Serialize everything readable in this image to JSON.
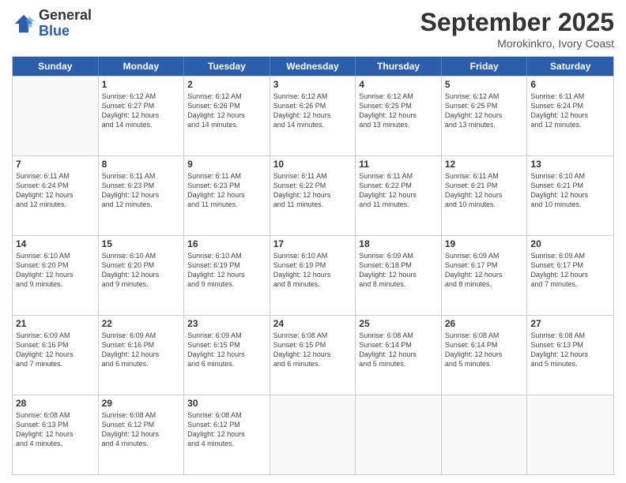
{
  "header": {
    "logo_general": "General",
    "logo_blue": "Blue",
    "month": "September 2025",
    "location": "Morokinkro, Ivory Coast"
  },
  "weekdays": [
    "Sunday",
    "Monday",
    "Tuesday",
    "Wednesday",
    "Thursday",
    "Friday",
    "Saturday"
  ],
  "weeks": [
    [
      {
        "day": null,
        "info": null
      },
      {
        "day": "1",
        "info": "Sunrise: 6:12 AM\nSunset: 6:27 PM\nDaylight: 12 hours\nand 14 minutes."
      },
      {
        "day": "2",
        "info": "Sunrise: 6:12 AM\nSunset: 6:26 PM\nDaylight: 12 hours\nand 14 minutes."
      },
      {
        "day": "3",
        "info": "Sunrise: 6:12 AM\nSunset: 6:26 PM\nDaylight: 12 hours\nand 14 minutes."
      },
      {
        "day": "4",
        "info": "Sunrise: 6:12 AM\nSunset: 6:25 PM\nDaylight: 12 hours\nand 13 minutes."
      },
      {
        "day": "5",
        "info": "Sunrise: 6:12 AM\nSunset: 6:25 PM\nDaylight: 12 hours\nand 13 minutes."
      },
      {
        "day": "6",
        "info": "Sunrise: 6:11 AM\nSunset: 6:24 PM\nDaylight: 12 hours\nand 12 minutes."
      }
    ],
    [
      {
        "day": "7",
        "info": "Sunrise: 6:11 AM\nSunset: 6:24 PM\nDaylight: 12 hours\nand 12 minutes."
      },
      {
        "day": "8",
        "info": "Sunrise: 6:11 AM\nSunset: 6:23 PM\nDaylight: 12 hours\nand 12 minutes."
      },
      {
        "day": "9",
        "info": "Sunrise: 6:11 AM\nSunset: 6:23 PM\nDaylight: 12 hours\nand 11 minutes."
      },
      {
        "day": "10",
        "info": "Sunrise: 6:11 AM\nSunset: 6:22 PM\nDaylight: 12 hours\nand 11 minutes."
      },
      {
        "day": "11",
        "info": "Sunrise: 6:11 AM\nSunset: 6:22 PM\nDaylight: 12 hours\nand 11 minutes."
      },
      {
        "day": "12",
        "info": "Sunrise: 6:11 AM\nSunset: 6:21 PM\nDaylight: 12 hours\nand 10 minutes."
      },
      {
        "day": "13",
        "info": "Sunrise: 6:10 AM\nSunset: 6:21 PM\nDaylight: 12 hours\nand 10 minutes."
      }
    ],
    [
      {
        "day": "14",
        "info": "Sunrise: 6:10 AM\nSunset: 6:20 PM\nDaylight: 12 hours\nand 9 minutes."
      },
      {
        "day": "15",
        "info": "Sunrise: 6:10 AM\nSunset: 6:20 PM\nDaylight: 12 hours\nand 9 minutes."
      },
      {
        "day": "16",
        "info": "Sunrise: 6:10 AM\nSunset: 6:19 PM\nDaylight: 12 hours\nand 9 minutes."
      },
      {
        "day": "17",
        "info": "Sunrise: 6:10 AM\nSunset: 6:19 PM\nDaylight: 12 hours\nand 8 minutes."
      },
      {
        "day": "18",
        "info": "Sunrise: 6:09 AM\nSunset: 6:18 PM\nDaylight: 12 hours\nand 8 minutes."
      },
      {
        "day": "19",
        "info": "Sunrise: 6:09 AM\nSunset: 6:17 PM\nDaylight: 12 hours\nand 8 minutes."
      },
      {
        "day": "20",
        "info": "Sunrise: 6:09 AM\nSunset: 6:17 PM\nDaylight: 12 hours\nand 7 minutes."
      }
    ],
    [
      {
        "day": "21",
        "info": "Sunrise: 6:09 AM\nSunset: 6:16 PM\nDaylight: 12 hours\nand 7 minutes."
      },
      {
        "day": "22",
        "info": "Sunrise: 6:09 AM\nSunset: 6:16 PM\nDaylight: 12 hours\nand 6 minutes."
      },
      {
        "day": "23",
        "info": "Sunrise: 6:09 AM\nSunset: 6:15 PM\nDaylight: 12 hours\nand 6 minutes."
      },
      {
        "day": "24",
        "info": "Sunrise: 6:08 AM\nSunset: 6:15 PM\nDaylight: 12 hours\nand 6 minutes."
      },
      {
        "day": "25",
        "info": "Sunrise: 6:08 AM\nSunset: 6:14 PM\nDaylight: 12 hours\nand 5 minutes."
      },
      {
        "day": "26",
        "info": "Sunrise: 6:08 AM\nSunset: 6:14 PM\nDaylight: 12 hours\nand 5 minutes."
      },
      {
        "day": "27",
        "info": "Sunrise: 6:08 AM\nSunset: 6:13 PM\nDaylight: 12 hours\nand 5 minutes."
      }
    ],
    [
      {
        "day": "28",
        "info": "Sunrise: 6:08 AM\nSunset: 6:13 PM\nDaylight: 12 hours\nand 4 minutes."
      },
      {
        "day": "29",
        "info": "Sunrise: 6:08 AM\nSunset: 6:12 PM\nDaylight: 12 hours\nand 4 minutes."
      },
      {
        "day": "30",
        "info": "Sunrise: 6:08 AM\nSunset: 6:12 PM\nDaylight: 12 hours\nand 4 minutes."
      },
      {
        "day": null,
        "info": null
      },
      {
        "day": null,
        "info": null
      },
      {
        "day": null,
        "info": null
      },
      {
        "day": null,
        "info": null
      }
    ]
  ]
}
